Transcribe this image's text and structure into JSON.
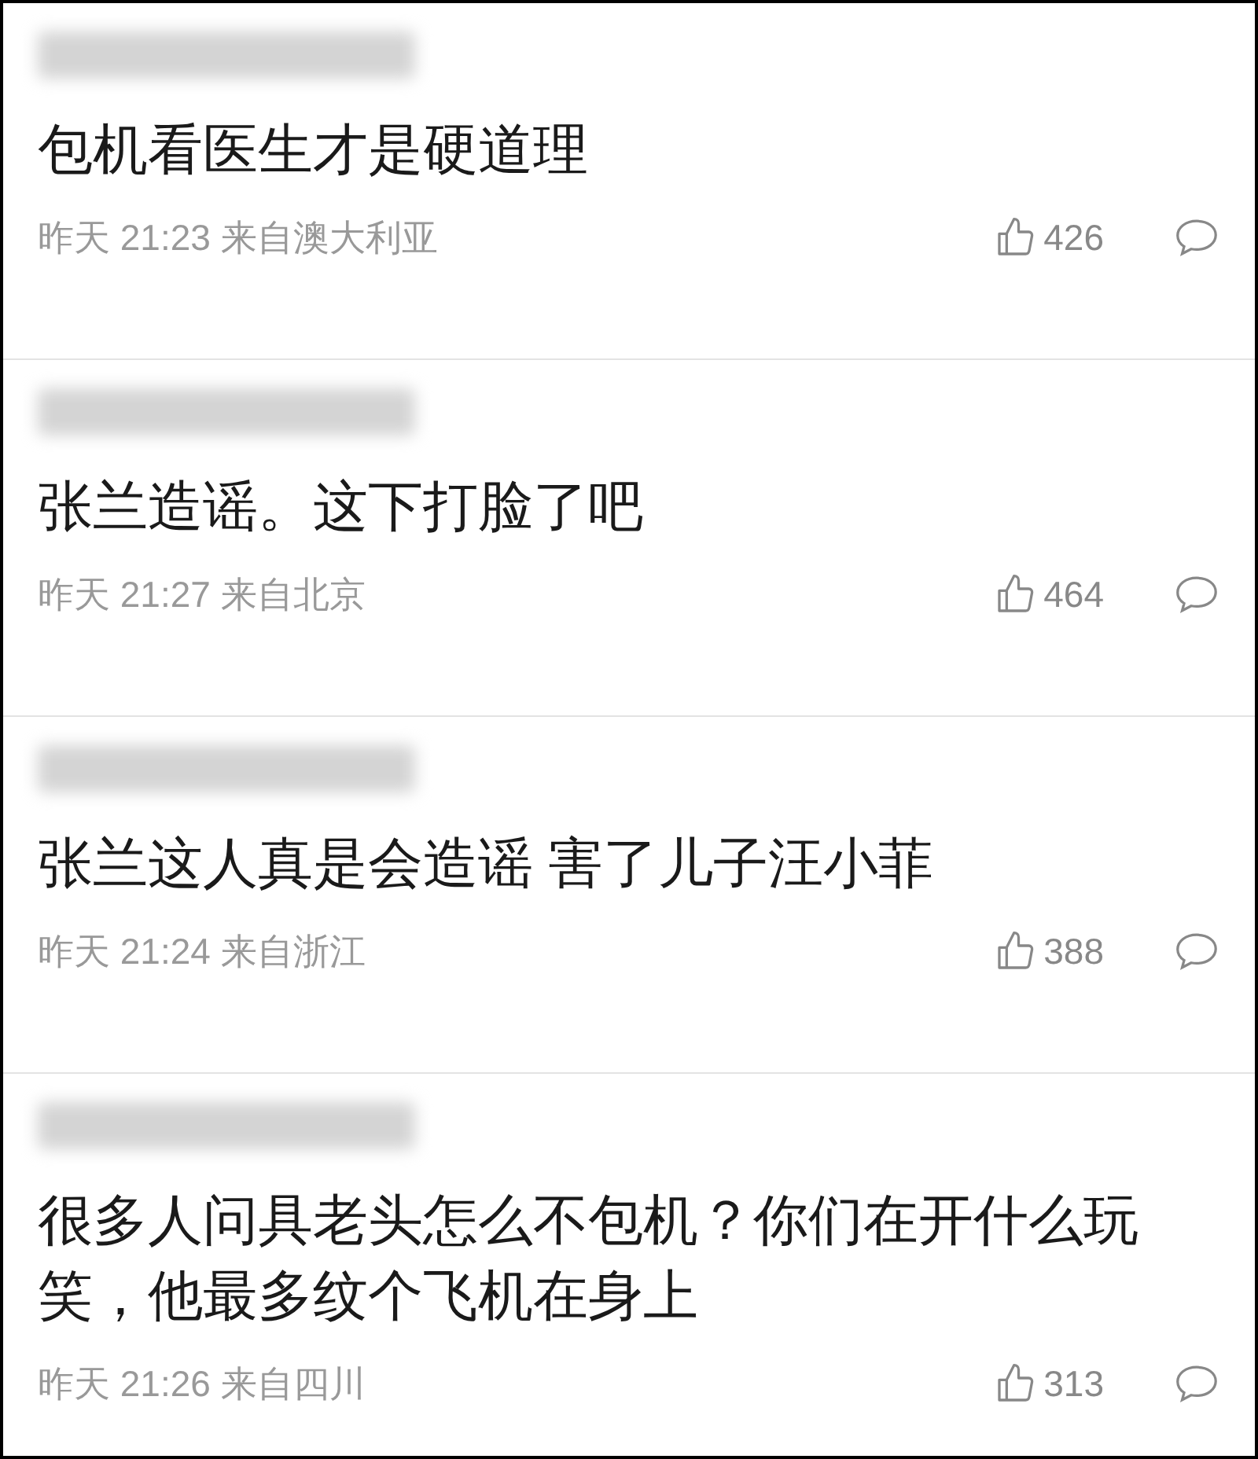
{
  "comments": [
    {
      "text": "包机看医生才是硬道理",
      "time": "昨天 21:23 来自澳大利亚",
      "likes": "426"
    },
    {
      "text": "张兰造谣。这下打脸了吧",
      "time": "昨天 21:27 来自北京",
      "likes": "464"
    },
    {
      "text": "张兰这人真是会造谣 害了儿子汪小菲",
      "time": "昨天 21:24 来自浙江",
      "likes": "388"
    },
    {
      "text": "很多人问具老头怎么不包机？你们在开什么玩笑，他最多纹个飞机在身上",
      "time": "昨天 21:26 来自四川",
      "likes": "313"
    }
  ]
}
